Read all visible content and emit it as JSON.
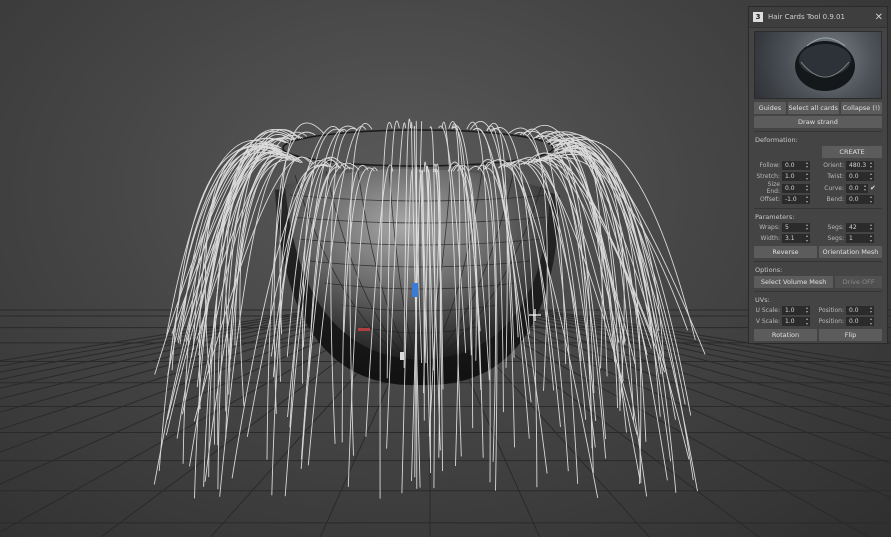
{
  "panel": {
    "icon_glyph": "3",
    "title": "Hair Cards Tool 0.9.01",
    "close_glyph": "✕",
    "buttons_top": [
      "Guides",
      "Select all cards",
      "Collapse (!)"
    ],
    "draw_strand": "Draw strand",
    "deformation": {
      "label": "Deformation:",
      "create": "CREATE",
      "rows": [
        {
          "l1": "Follow:",
          "v1": "0.0",
          "l2": "Orient:",
          "v2": "480.3"
        },
        {
          "l1": "Stretch:",
          "v1": "1.0",
          "l2": "Twist:",
          "v2": "0.0"
        },
        {
          "l1": "Size End:",
          "v1": "0.0",
          "l2": "Curve:",
          "v2": "0.0"
        },
        {
          "l1": "Offset:",
          "v1": "-1.0",
          "l2": "Bend:",
          "v2": "0.0"
        }
      ]
    },
    "parameters": {
      "label": "Parameters:",
      "rows": [
        {
          "l1": "Wraps:",
          "v1": "5",
          "l2": "Segs:",
          "v2": "42"
        },
        {
          "l1": "Width:",
          "v1": "3.1",
          "l2": "Segs:",
          "v2": "1"
        }
      ],
      "reverse": "Reverse",
      "orientation_mesh": "Orientation Mesh"
    },
    "options": {
      "label": "Options:",
      "select_volume_mesh": "Select Volume Mesh",
      "drive_off": "Drive OFF"
    },
    "uvs": {
      "label": "UVs:",
      "rows": [
        {
          "l1": "U Scale:",
          "v1": "1.0",
          "l2": "Position:",
          "v2": "0.0"
        },
        {
          "l1": "V Scale:",
          "v1": "1.0",
          "l2": "Position:",
          "v2": "0.0"
        }
      ],
      "rotation": "Rotation",
      "flip": "Flip"
    }
  },
  "viewport": {
    "icons": [
      "move-cursor-icon",
      "viewport-gizmo-icon"
    ]
  }
}
